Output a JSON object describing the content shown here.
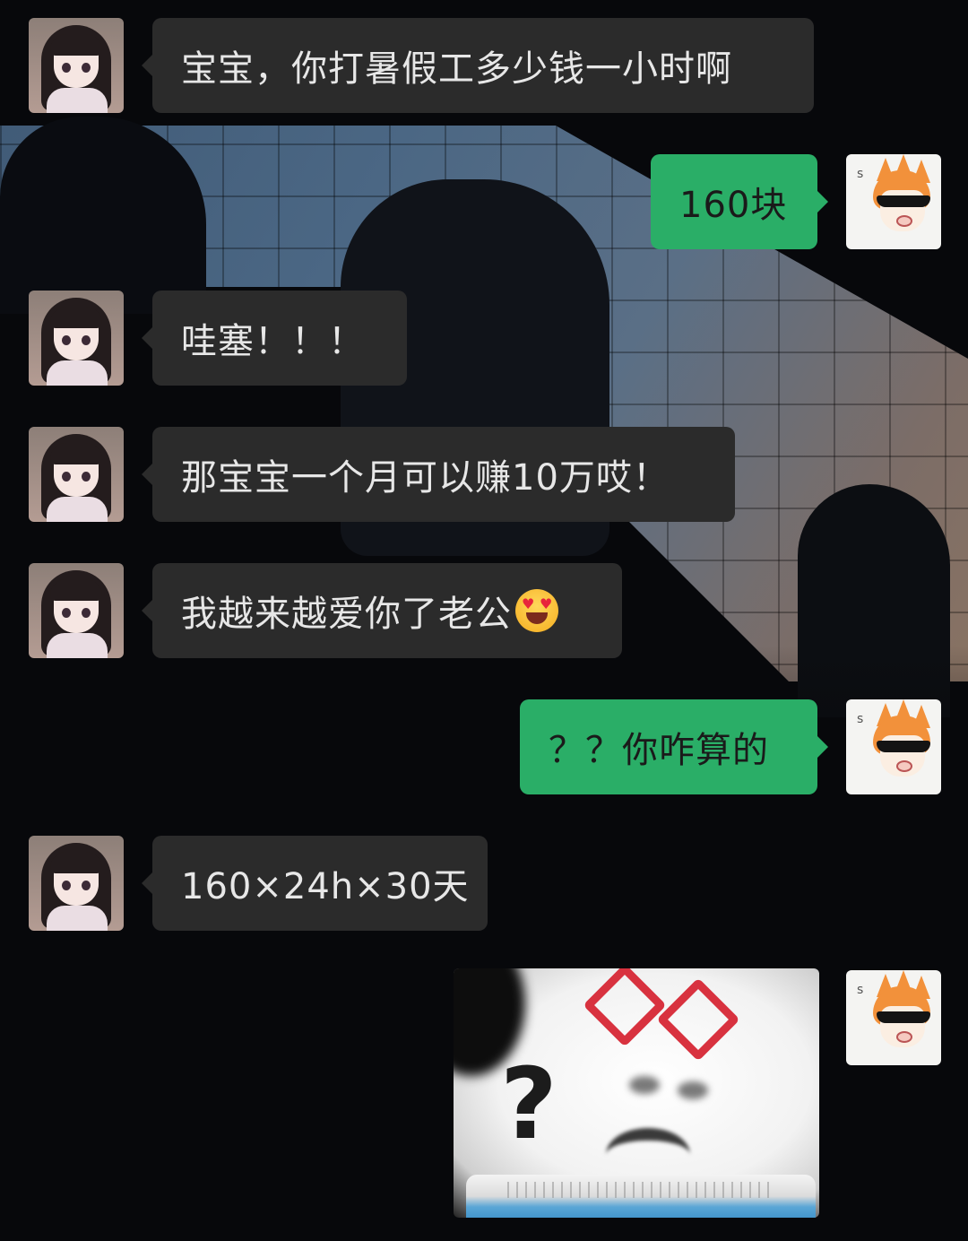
{
  "chat": {
    "messages": [
      {
        "side": "received",
        "text": "宝宝，你打暑假工多少钱一小时啊"
      },
      {
        "side": "sent",
        "text": "160块"
      },
      {
        "side": "received",
        "text": "哇塞！！！"
      },
      {
        "side": "received",
        "text": "那宝宝一个月可以赚10万哎！"
      },
      {
        "side": "received",
        "text": "我越来越爱你了老公",
        "emoji": "heart-eyes-emoji"
      },
      {
        "side": "sent",
        "text": "？？你咋算的"
      },
      {
        "side": "received",
        "text": "160×24h×30天"
      },
      {
        "side": "sent",
        "type": "sticker",
        "sticker": "confused-question-mark-sticker"
      }
    ]
  },
  "colors": {
    "background": "#07080b",
    "received_bubble": "#2b2b2b",
    "received_text": "#e7e7e7",
    "sent_bubble": "#2aae67",
    "sent_text": "#1a1a1a"
  },
  "avatars": {
    "received": "girl-avatar",
    "sent": "boy-sunglasses-avatar"
  }
}
